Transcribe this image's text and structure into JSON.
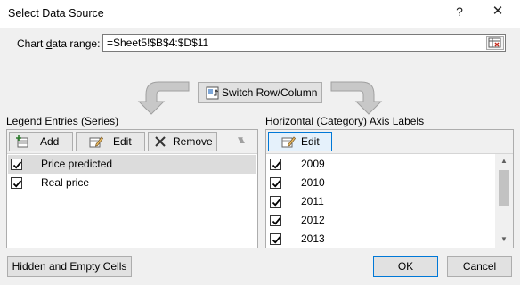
{
  "window": {
    "title": "Select Data Source",
    "help": "?",
    "close": "✕"
  },
  "range": {
    "label": "Chart data range:",
    "value": "=Sheet5!$B$4:$D$11"
  },
  "switch_button": {
    "label": "Switch Row/Column"
  },
  "legend": {
    "label": "Legend Entries (Series)",
    "add": "Add",
    "edit": "Edit",
    "remove": "Remove",
    "items": [
      {
        "label": "Price predicted",
        "checked": true,
        "selected": true
      },
      {
        "label": "Real price",
        "checked": true,
        "selected": false
      }
    ]
  },
  "axis": {
    "label": "Horizontal (Category) Axis Labels",
    "edit": "Edit",
    "items": [
      {
        "label": "2009",
        "checked": true
      },
      {
        "label": "2010",
        "checked": true
      },
      {
        "label": "2011",
        "checked": true
      },
      {
        "label": "2012",
        "checked": true
      },
      {
        "label": "2013",
        "checked": true
      }
    ]
  },
  "footer": {
    "hidden_cells": "Hidden and Empty Cells",
    "ok": "OK",
    "cancel": "Cancel"
  },
  "colors": {
    "accent": "#0078d7",
    "selected_row": "#dcdcdc",
    "button": "#e1e1e1"
  }
}
